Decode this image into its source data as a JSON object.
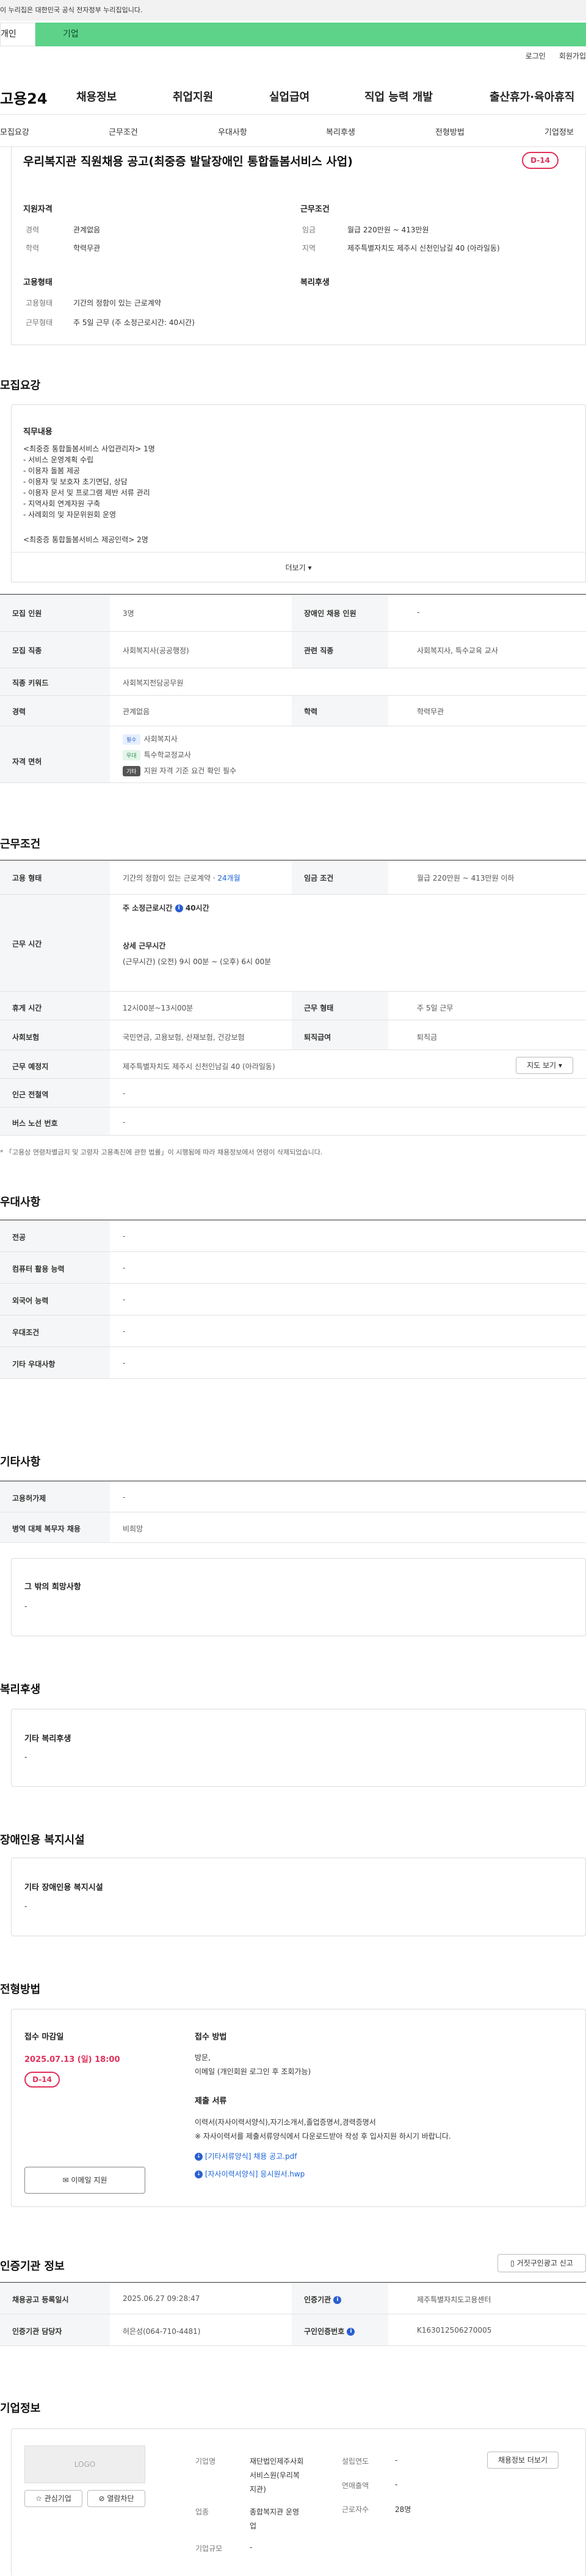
{
  "topbar": {
    "notice": "이 누리집은 대한민국 공식 전자정부 누리집입니다."
  },
  "tabs": {
    "personal": "개인",
    "corp": "기업"
  },
  "util": {
    "login": "로그인",
    "join": "회원가입"
  },
  "gnb": {
    "logo": "고용24",
    "items": [
      "채용정보",
      "취업지원",
      "실업급여",
      "직업 능력 개발",
      "출산휴가·육아휴직"
    ]
  },
  "subnav": {
    "items": [
      "모집요강",
      "근무조건",
      "우대사항",
      "복리후생",
      "전형방법",
      "기업정보"
    ]
  },
  "job": {
    "title": "우리복지관 직원채용 공고(최중증 발달장애인 통합돌봄서비스 사업)",
    "dday": "D-14"
  },
  "summary": {
    "qual_head": "지원자격",
    "cond_head": "근무조건",
    "type_head": "고용형태",
    "welfare_head": "복리후생",
    "career_label": "경력",
    "career_val": "관계없음",
    "edu_label": "학력",
    "edu_val": "학력무관",
    "wage_label": "임금",
    "wage_val": "월급 220만원 ~ 413만원",
    "loc_label": "지역",
    "loc_val": "제주특별자치도 제주시 신천인남길 40 (아라일동)",
    "emp_label": "고용형태",
    "emp_val": "기간의 정함이 있는 근로계약",
    "work_label": "근무형태",
    "work_val": "주 5일 근무 (주 소정근로시간: 40시간)"
  },
  "recruit": {
    "title": "모집요강",
    "duty_head": "직무내용",
    "duty_lines": [
      "<최중증 통합돌봄서비스 사업관리자> 1명",
      "- 서비스 운영계획 수립",
      "- 이용자 돌봄 제공",
      "- 이용자 및 보호자 초기면담, 상담",
      "- 이용자 문서 및 프로그램 제반 서류 관리",
      "- 지역사회 연계자원 구축",
      "- 사례회의 및 자문위원회 운영",
      "",
      "<최중증 통합돌봄서비스 제공인력> 2명"
    ],
    "more": "더보기 ▾",
    "rows": {
      "headcount_l": "모집 인원",
      "headcount_v": "3명",
      "disabled_l": "장애인 채용 인원",
      "disabled_v": "-",
      "job_l": "모집 직종",
      "job_v": "사회복지사(공공행정)",
      "related_l": "관련 직종",
      "related_v": "사회복지사, 특수교육 교사",
      "kw_l": "직종 키워드",
      "kw_v": "사회복지전담공무원",
      "career_l": "경력",
      "career_v": "관계없음",
      "edu_l": "학력",
      "edu_v": "학력무관",
      "lic_l": "자격 면허",
      "lic_badge1": "필수",
      "lic1": "사회복지사",
      "lic_badge2": "우대",
      "lic2": "특수학교정교사",
      "lic_badge3": "기타",
      "lic3": "지원 자격 기준 요건 확인 필수"
    }
  },
  "conditions": {
    "title": "근무조건",
    "emp_l": "고용 형태",
    "emp_v": "기간의 정함이 있는 근로계약 · ",
    "emp_link": "24개월",
    "wage_l": "임금 조건",
    "wage_v": "월급 220만원 ~ 413만원 이하",
    "hours_l": "근무 시간",
    "hours_head": "주 소정근로시간",
    "hours_info": "i",
    "hours_val": "40시간",
    "hours_detail_head": "상세 근무시간",
    "hours_detail": "(근무시간) (오전) 9시 00분 ~ (오후) 6시 00분",
    "break_l": "휴게 시간",
    "break_v": "12시00분~13시00분",
    "worktype_l": "근무 형태",
    "worktype_v": "주 5일 근무",
    "ins_l": "사회보험",
    "ins_v": "국민연금, 고용보험, 산재보험, 건강보험",
    "sev_l": "퇴직급여",
    "sev_v": "퇴직금",
    "place_l": "근무 예정지",
    "place_v": "제주특별자치도 제주시 신천인남길 40 (아라일동)",
    "map_btn": "지도 보기 ▾",
    "subway_l": "인근 전철역",
    "subway_v": "-",
    "bus_l": "버스 노선 번호",
    "bus_v": "-",
    "footnote": "* 「고용상 연령차별금지 및 고령자 고용촉진에 관한 법률」이 시행됨에 따라 채용정보에서 연령이 삭제되었습니다."
  },
  "preference": {
    "title": "우대사항",
    "rows": [
      [
        "전공",
        "-"
      ],
      [
        "컴퓨터 활용 능력",
        "-"
      ],
      [
        "외국어 능력",
        "-"
      ],
      [
        "우대조건",
        "-"
      ],
      [
        "기타 우대사항",
        "-"
      ]
    ]
  },
  "etc": {
    "title": "기타사항",
    "rows": [
      [
        "고용허가제",
        "-"
      ],
      [
        "병역 대체 복무자 채용",
        "비희망"
      ]
    ],
    "other_head": "그 밖의 희망사항",
    "other_val": "-"
  },
  "welfare": {
    "title": "복리후생",
    "head": "기타 복리후생",
    "val": "-"
  },
  "disability": {
    "title": "장애인용 복지시설",
    "head": "기타 장애인용 복지시설",
    "val": "-"
  },
  "process": {
    "title": "전형방법",
    "deadline_head": "접수 마감일",
    "deadline_val": "2025.07.13 (일) 18:00",
    "dday": "D-14",
    "apply_btn": "이메일 지원",
    "method_head": "접수 방법",
    "method_val1": "방문,",
    "method_val2": "이메일 (개인회원 로그인 후 조회가능)",
    "docs_head": "제출 서류",
    "docs_val1": "이력서(자사이력서양식),자기소개서,졸업증명서,경력증명서",
    "docs_val2": "※ 자사이력서를 제출서류양식에서 다운로드받아 작성 후 입사지원 하시기 바랍니다.",
    "file1": "[기타서류양식] 채용 공고.pdf",
    "file2": "[자사이력서양식] 응시원서.hwp"
  },
  "cert": {
    "title": "인증기관 정보",
    "btn": "거짓구인광고 신고",
    "reg_l": "채용공고 등록일시",
    "reg_v": "2025.06.27 09:28:47",
    "agency_l": "인증기관",
    "agency_v": "제주특별자치도고용센터",
    "mgr_l": "인증기관 담당자",
    "mgr_v": "허은성(064-710-4481)",
    "num_l": "구인인증번호",
    "num_v": "K163012506270005"
  },
  "company": {
    "title": "기업정보",
    "logo": "LOGO",
    "fav_btn": "관심기업",
    "block_btn": "열람차단",
    "name_l": "기업명",
    "name_v1": "재단법인제주사회",
    "name_v2": "서비스원(우리복",
    "name_v3": "지관)",
    "year_l": "설립연도",
    "year_v": "-",
    "info_btn": "채용정보 더보기",
    "sales_l": "연매출액",
    "sales_v": "-",
    "ind_l": "업종",
    "ind_v1": "종합복지관 운영",
    "ind_v2": "업",
    "emp_l": "근로자수",
    "emp_v": "28명",
    "scale_l": "기업규모",
    "scale_v": "-"
  }
}
